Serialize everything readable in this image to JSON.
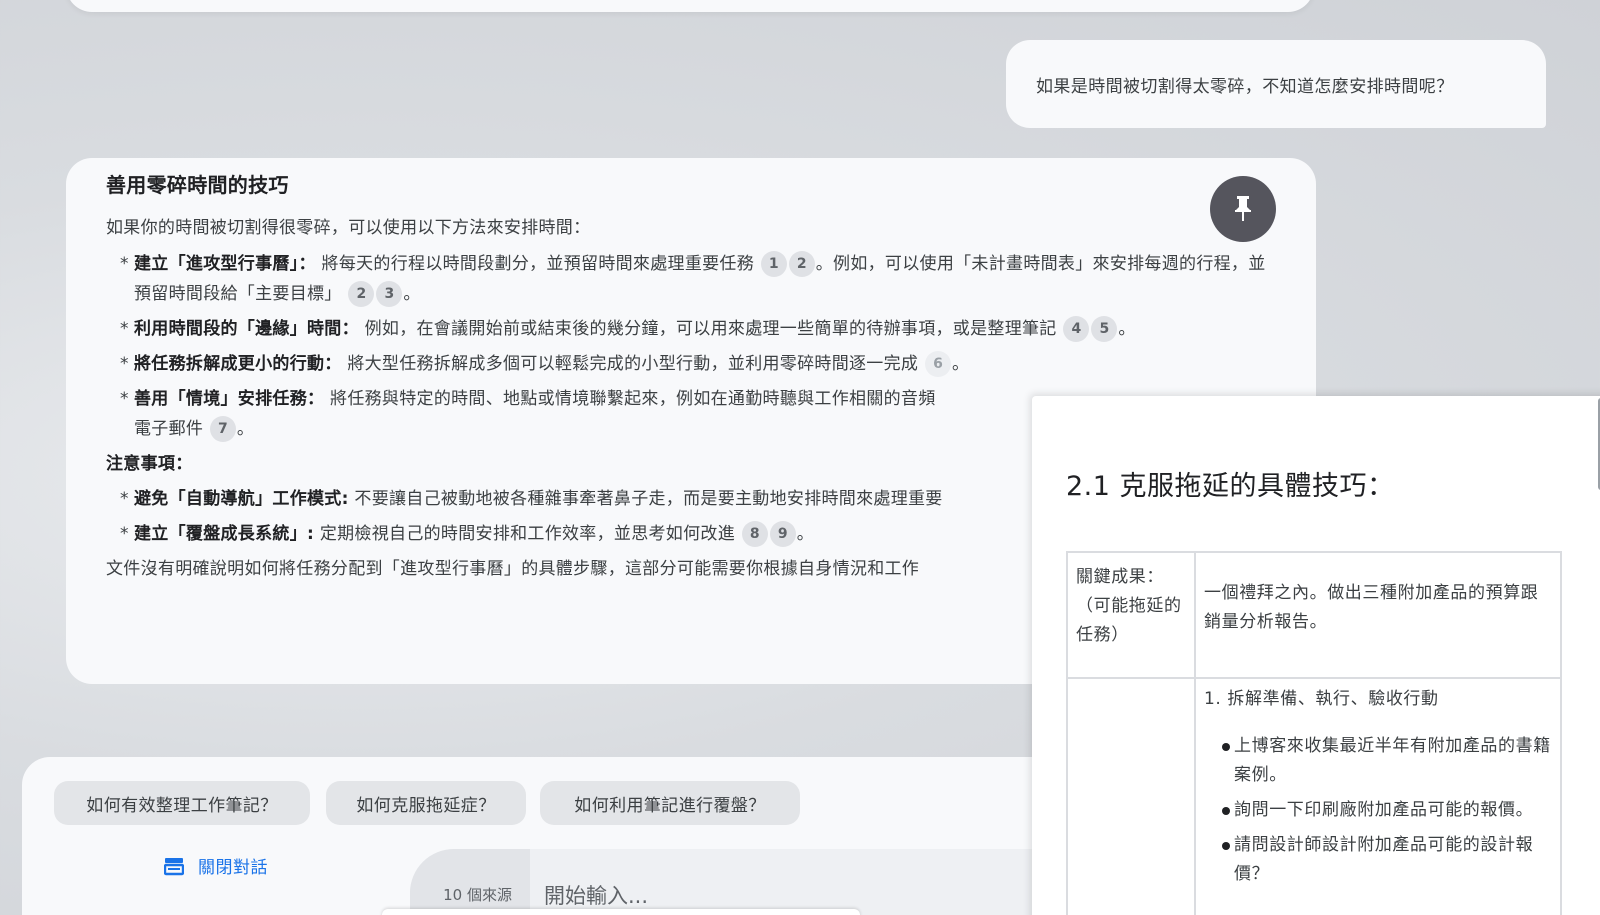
{
  "user_message": "如果是時間被切割得太零碎，不知道怎麼安排時間呢？",
  "answer": {
    "title": "善用零碎時間的技巧",
    "intro": "如果你的時間被切割得很零碎，可以使用以下方法來安排時間：",
    "bullets": [
      {
        "bold": "建立「進攻型行事曆」：",
        "text": " 將每天的行程以時間段劃分，並預留時間來處理重要任務",
        "cites": [
          "1",
          "2"
        ],
        "text2": "。例如，可以使用「未計畫時間表」來安排每週的行程，並預留時間段給「主要目標」",
        "cites2": [
          "2",
          "3"
        ],
        "end": "。"
      },
      {
        "bold": "利用時間段的「邊緣」時間：",
        "text": " 例如，在會議開始前或結束後的幾分鐘，可以用來處理一些簡單的待辦事項，或是整理筆記",
        "cites": [
          "4",
          "5"
        ],
        "end": "。"
      },
      {
        "bold": "將任務拆解成更小的行動：",
        "text": " 將大型任務拆解成多個可以輕鬆完成的小型行動，並利用零碎時間逐一完成",
        "cites": [
          "6"
        ],
        "end": "。"
      },
      {
        "bold": "善用「情境」安排任務：",
        "text": " 將任務與特定的時間、地點或情境聯繫起來，例如在通勤時聽與工作相關的音頻",
        "text2": "電子郵件",
        "cites": [
          "7"
        ],
        "end": "。"
      }
    ],
    "notes_heading": "注意事項：",
    "notes": [
      {
        "bold": "避免「自動導航」工作模式:",
        "text": " 不要讓自己被動地被各種雜事牽著鼻子走，而是要主動地安排時間來處理重要"
      },
      {
        "bold": "建立「覆盤成長系統」:",
        "text": " 定期檢視自己的時間安排和工作效率，並思考如何改進",
        "cites": [
          "8",
          "9"
        ],
        "end": "。"
      }
    ],
    "closing": "文件沒有明確說明如何將任務分配到「進攻型行事曆」的具體步驟，這部分可能需要你根據自身情況和工作"
  },
  "pin_icon": "pin-icon",
  "suggestions": [
    "如何有效整理工作筆記？",
    "如何克服拖延症？",
    "如何利用筆記進行覆盤？"
  ],
  "close_chat_label": "關閉對話",
  "close_chat_icon": "chat-panel-icon",
  "sources_count": "10 個來源",
  "input_placeholder": "開始輸入...",
  "source_doc": {
    "heading": "2.1 克服拖延的具體技巧：",
    "row1_label": "關鍵成果：（可能拖延的任務）",
    "row1_value": "一個禮拜之內。做出三種附加產品的預算跟銷量分析報告。",
    "row2_step": "1. 拆解準備、執行、驗收行動",
    "row2_items": [
      "上博客來收集最近半年有附加產品的書籍案例。",
      "詢問一下印刷廠附加產品可能的報價。",
      "請問設計師設計附加產品可能的設計報價？"
    ]
  }
}
